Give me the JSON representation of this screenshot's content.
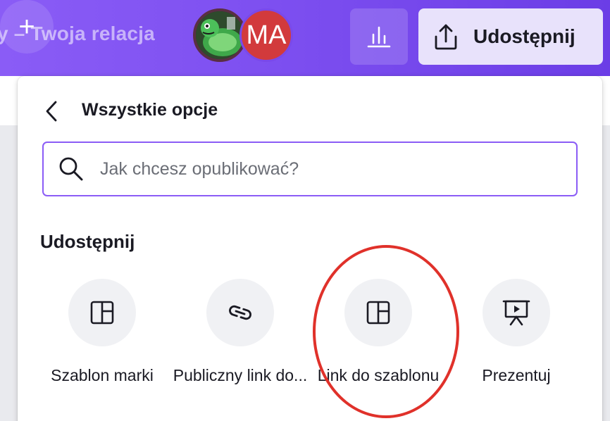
{
  "header": {
    "doc_title": "y – Twoja relacja",
    "avatar_initials": "MA",
    "add_collaborator_glyph": "+",
    "share_label": "Udostępnij"
  },
  "panel": {
    "title": "Wszystkie opcje",
    "search": {
      "placeholder": "Jak chcesz opublikować?",
      "value": ""
    },
    "section_title": "Udostępnij",
    "options": [
      {
        "label": "Szablon marki",
        "icon": "template-layout-icon"
      },
      {
        "label": "Publiczny link do...",
        "icon": "link-icon"
      },
      {
        "label": "Link do szablonu",
        "icon": "template-layout-icon"
      },
      {
        "label": "Prezentuj",
        "icon": "presentation-icon"
      }
    ]
  },
  "colors": {
    "topbar_gradient_start": "#8a5cf6",
    "topbar_gradient_end": "#6b3de6",
    "search_border": "#8b5cf6",
    "share_button_bg": "#e8e2fb",
    "avatar_ma_bg": "#d23a3c",
    "highlight_annotation": "#e0312a"
  }
}
